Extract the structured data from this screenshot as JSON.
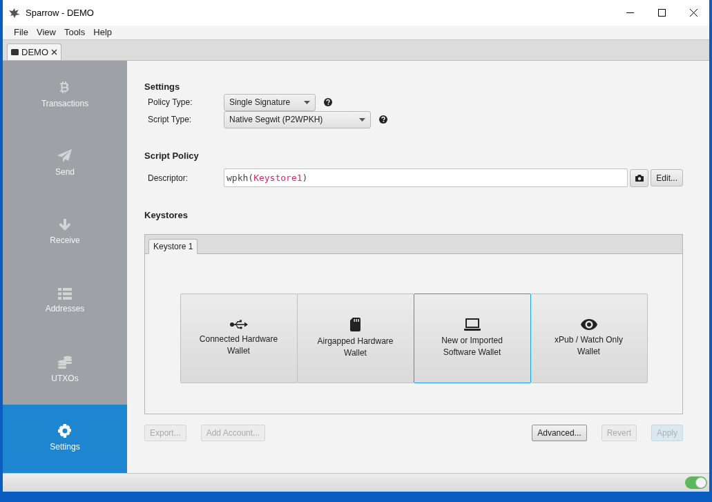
{
  "window": {
    "title": "Sparrow - DEMO"
  },
  "menu": [
    "File",
    "View",
    "Tools",
    "Help"
  ],
  "tabs": [
    {
      "label": "DEMO",
      "selected": true
    }
  ],
  "sidebar": {
    "items": [
      {
        "label": "Transactions",
        "kind": "bitcoin",
        "selected": false
      },
      {
        "label": "Send",
        "kind": "send",
        "selected": false
      },
      {
        "label": "Receive",
        "kind": "receive",
        "selected": false
      },
      {
        "label": "Addresses",
        "kind": "list",
        "selected": false
      },
      {
        "label": "UTXOs",
        "kind": "coins",
        "selected": false
      },
      {
        "label": "Settings",
        "kind": "gear",
        "selected": true
      }
    ]
  },
  "settings": {
    "title": "Settings",
    "fields": [
      {
        "label": "Policy Type:",
        "value": "Single Signature"
      },
      {
        "label": "Script Type:",
        "value": "Native Segwit (P2WPKH)"
      }
    ]
  },
  "script_policy": {
    "title": "Script Policy",
    "label": "Descriptor:",
    "descriptor": [
      {
        "text": "wpkh(",
        "kind": "plain"
      },
      {
        "text": "Keystore1",
        "kind": "key"
      },
      {
        "text": ")",
        "kind": "plain"
      }
    ],
    "edit_button": "Edit..."
  },
  "keystores": {
    "title": "Keystores",
    "tabs": [
      {
        "label": "Keystore 1",
        "selected": true
      }
    ],
    "options": [
      {
        "label": "Connected Hardware Wallet",
        "kind": "usb",
        "selected": false
      },
      {
        "label": "Airgapped Hardware Wallet",
        "kind": "sdcard",
        "selected": false
      },
      {
        "label": "New or Imported Software Wallet",
        "kind": "laptop",
        "selected": true
      },
      {
        "label": "xPub / Watch Only Wallet",
        "kind": "eye",
        "selected": false
      }
    ]
  },
  "left_buttons": [
    {
      "label": "Export...",
      "disabled": true,
      "kind": "normal"
    },
    {
      "label": "Add Account...",
      "disabled": true,
      "kind": "normal"
    }
  ],
  "right_buttons": [
    {
      "label": "Advanced...",
      "disabled": false,
      "kind": "normal"
    },
    {
      "label": "Revert",
      "disabled": true,
      "kind": "normal"
    },
    {
      "label": "Apply",
      "disabled": true,
      "kind": "default"
    }
  ],
  "status_bar": {
    "toggle": {
      "on": true
    }
  }
}
